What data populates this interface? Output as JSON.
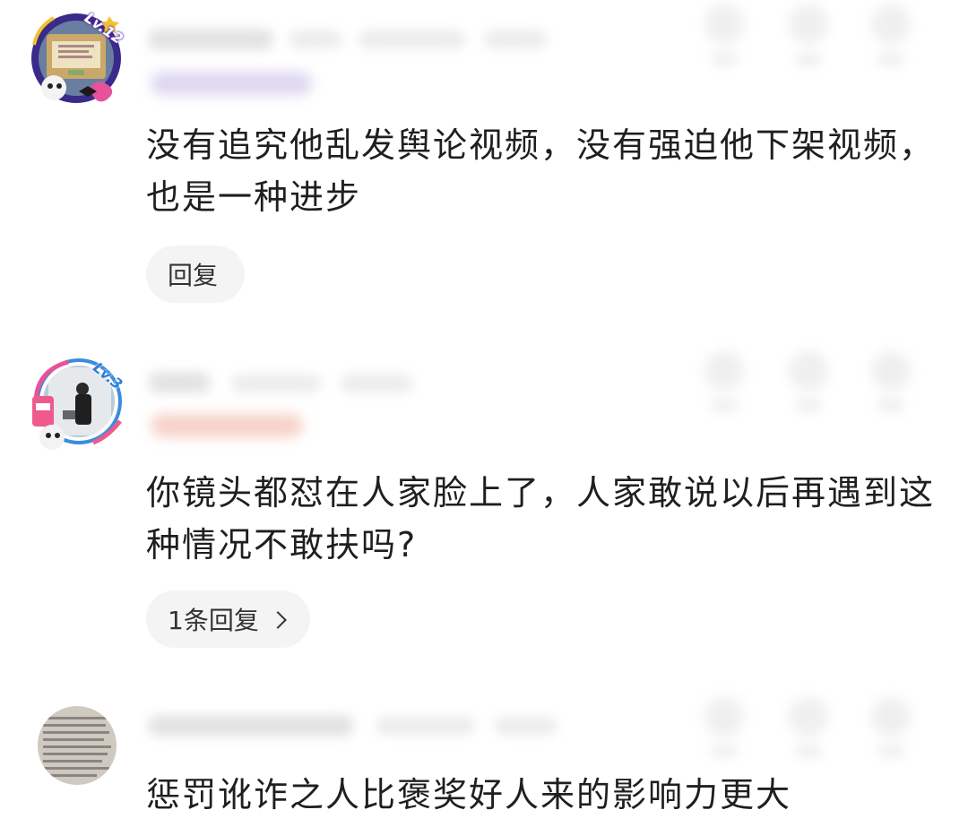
{
  "comments": [
    {
      "level_badge": "Lv.12",
      "text": "没有追究他乱发舆论视频，没有强迫他下架视频，也是一种进步",
      "reply_label": "回复"
    },
    {
      "level_badge": "Lv.3",
      "text": "你镜头都怼在人家脸上了，人家敢说以后再遇到这种情况不敢扶吗?",
      "reply_label": "1条回复",
      "reply_chevron_icon": "chevron-right-icon"
    },
    {
      "text": "惩罚讹诈之人比褒奖好人来的影响力更大"
    }
  ],
  "colors": {
    "comment_text": "#1f1f1f",
    "pill_background": "#f4f4f4",
    "blur_placeholder": "#e3e3e3"
  }
}
